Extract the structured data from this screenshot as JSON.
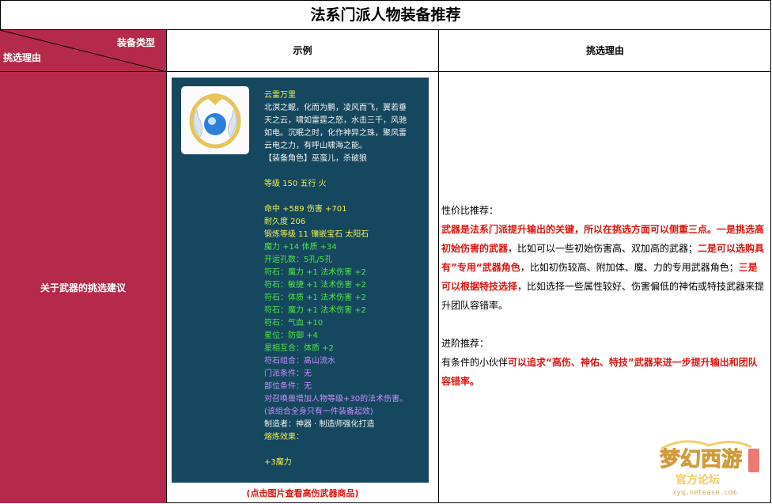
{
  "title": "法系门派人物装备推荐",
  "header": {
    "corner_top": "装备类型",
    "corner_bottom": "挑选理由",
    "example": "示例",
    "reason": "挑选理由"
  },
  "row": {
    "label": "关于武器的挑选建议",
    "caption": "(点击图片查看高伤武器商品)"
  },
  "item": {
    "name": "云雷万里",
    "desc": [
      "北溟之鲲，化而为鹏，凌风而飞，翼若垂",
      "天之云，啸如雷霆之怒，水击三千，风驰",
      "如电。沉眠之时，化作神异之珠，聚风雷",
      "云电之力，有呼山啸海之能。"
    ],
    "role": "【装备角色】巫蛮儿，杀破狼",
    "level": "等级 150  五行 火",
    "attrs": "命中 +589 伤害 +701",
    "durability": "耐久度 206",
    "forge": "锻炼等级 11 镶嵌宝石 太阳石",
    "green1": "魔力 +14 体质 +34",
    "holes": "开运孔数：5孔/5孔",
    "runes": [
      "符石：魔力 +1 法术伤害 +2",
      "符石：敏捷 +1 法术伤害 +2",
      "符石：体质 +1 法术伤害 +2",
      "符石：魔力 +1 法术伤害 +2",
      "符石：气血 +10"
    ],
    "star": "星位：防御 +4",
    "star_combo": "星相互合：体质 +2",
    "rune_combo": "符石组合：高山流水",
    "sect_cond": "门派条件：无",
    "slot_cond": "部位条件：无",
    "combo_effect": "对召唤兽增加人物等级+30的法术伤害。",
    "combo_note": "(该组合全身只有一件装备起效)",
    "maker": "制造者：神器 · 制造师强化打造",
    "melt": "熔炼效果：",
    "melt_value": "+3魔力"
  },
  "reason": {
    "p1_label": "性价比推荐：",
    "p1_r1": "武器是法系门派提升输出的关键，所以在挑选方面可以侧重三点。一是挑选高初始伤害的武器",
    "p1_b1": "，比如可以一些初始伤害高、双加高的武器；",
    "p1_r2": "二是可以选购具有”专用“武器角色",
    "p1_b2": "，比如初伤较高、附加体、魔、力的专用武器角色；",
    "p1_r3": "三是可以根据特技选择",
    "p1_b3": "，比如选择一些属性较好、伤害偏低的神佑或特技武器来提升团队容错率。",
    "p2_label": "进阶推荐：",
    "p2_b1": "有条件的小伙伴",
    "p2_r1": "可以追求“高伤、神佑、特技”武器来进一步提升输出和团队容错率。"
  },
  "logo": {
    "text": "梦幻西游",
    "sub": "官方论坛",
    "url": "xyq.netease.com"
  },
  "colors": {
    "crimson": "#b5294a",
    "panel": "#15475e",
    "red": "#e0150e"
  }
}
